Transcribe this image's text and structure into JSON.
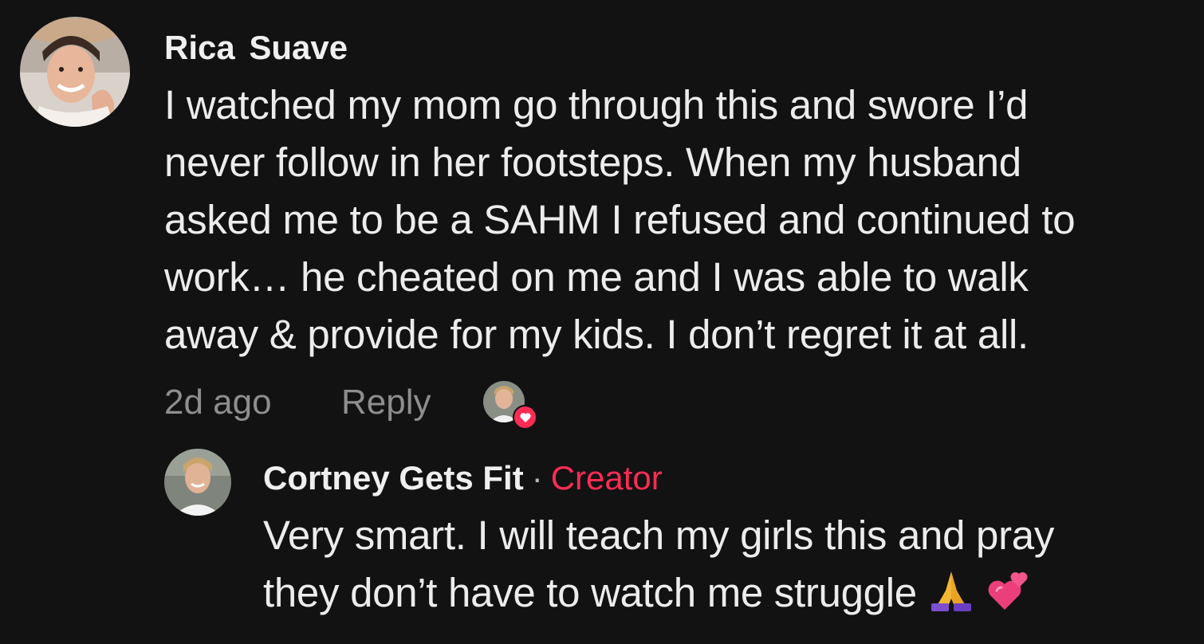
{
  "comment": {
    "username": "Rica  Suave",
    "text_lines": [
      "I watched my mom go through this and swore I’d",
      "never follow in her footsteps. When my husband",
      "asked me to be a SAHM I refused and continued to",
      "work… he cheated on me and I was able to walk",
      "away & provide for my kids. I don’t regret it at all."
    ],
    "timestamp": "2d ago",
    "reply_label": "Reply",
    "liked_by_creator_icon": "heart-icon"
  },
  "reply": {
    "username": "Cortney Gets Fit",
    "separator": "·",
    "badge": "Creator",
    "text_lines": [
      "Very smart. I will teach my girls this and pray",
      "they don’t have to watch me struggle"
    ],
    "emojis": [
      "folded-hands-emoji",
      "two-hearts-emoji"
    ]
  },
  "colors": {
    "background": "#121212",
    "text": "#ececec",
    "muted": "#8e8e8e",
    "accent": "#fe2c55"
  }
}
